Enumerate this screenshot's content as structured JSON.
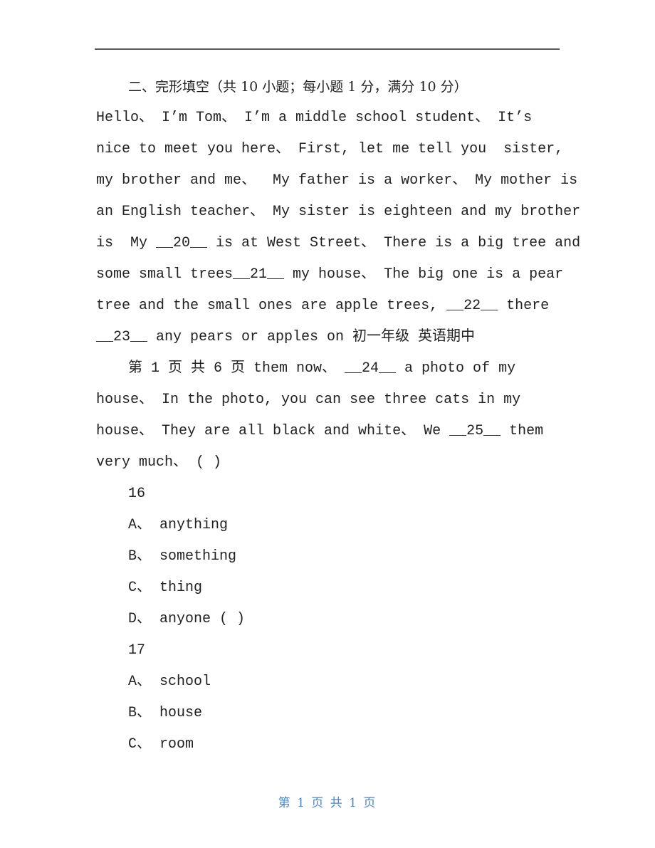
{
  "section": {
    "title": "二、完形填空（共 10 小题；每小题 1 分，满分 10 分）"
  },
  "passage": {
    "lines": [
      "Hello、 I’m Tom、 I’m a middle school student、 It’s",
      "nice to meet you here、 First, let me tell you  sister,",
      "my brother and me、  My father is a worker、 My mother is",
      "an English teacher、 My sister is eighteen and my brother",
      "is  My __20__ is at West Street、 There is a big tree and",
      "some small trees__21__ my house、 The big one is a pear",
      "tree and the small ones are apple trees, __22__ there",
      "__23__ any pears or apples on 初一年级 英语期中",
      "第 1 页 共 6 页 them now、 __24__ a photo of my",
      "house、 In the photo, you can see three cats in my",
      "house、 They are all black and white、 We __25__ them",
      "very much、 ( )"
    ]
  },
  "questions": [
    {
      "number": "16",
      "options": [
        {
          "letter": "A、",
          "text": "anything"
        },
        {
          "letter": "B、",
          "text": "something"
        },
        {
          "letter": "C、",
          "text": "thing"
        },
        {
          "letter": "D、",
          "text": "anyone ( )"
        }
      ]
    },
    {
      "number": "17",
      "options": [
        {
          "letter": "A、",
          "text": "school"
        },
        {
          "letter": "B、",
          "text": "house"
        },
        {
          "letter": "C、",
          "text": "room"
        }
      ]
    }
  ],
  "footer": {
    "page_label": "第 1 页 共 1 页"
  },
  "colors": {
    "text": "#222222",
    "rule": "#5a5a5e",
    "footer": "#4a86c8"
  }
}
